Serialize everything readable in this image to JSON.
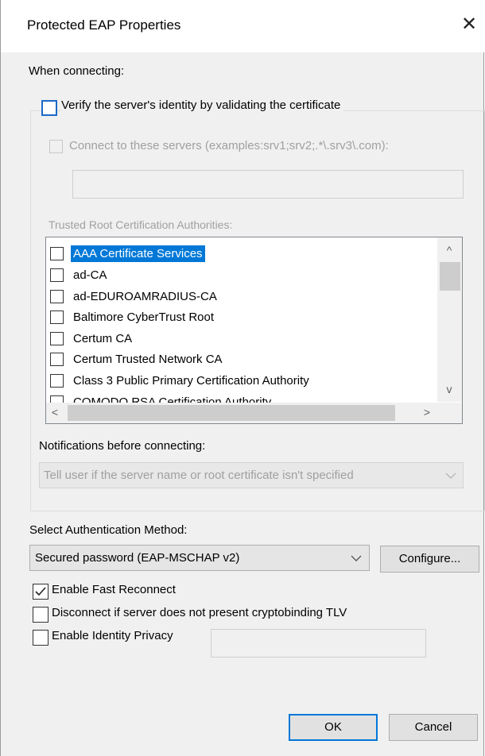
{
  "window": {
    "title": "Protected EAP Properties",
    "close_glyph": "✕"
  },
  "when_connecting": {
    "label": "When connecting:"
  },
  "verify_server": {
    "label": "Verify the server's identity by validating the certificate",
    "checked": false
  },
  "connect_servers": {
    "label": "Connect to these servers (examples:srv1;srv2;.*\\.srv3\\.com):",
    "checked": false,
    "value": ""
  },
  "trusted_roots": {
    "label": "Trusted Root Certification Authorities:",
    "items": [
      {
        "label": "AAA Certificate Services",
        "checked": false,
        "selected": true
      },
      {
        "label": "ad-CA",
        "checked": false
      },
      {
        "label": "ad-EDUROAMRADIUS-CA",
        "checked": false
      },
      {
        "label": "Baltimore CyberTrust Root",
        "checked": false
      },
      {
        "label": "Certum CA",
        "checked": false
      },
      {
        "label": "Certum Trusted Network CA",
        "checked": false
      },
      {
        "label": "Class 3 Public Primary Certification Authority",
        "checked": false
      },
      {
        "label": "COMODO RSA Certification Authority",
        "checked": false
      }
    ],
    "scroll_up": "^",
    "scroll_down": "v",
    "scroll_left": "<",
    "scroll_right": ">"
  },
  "notifications": {
    "label": "Notifications before connecting:",
    "value": "Tell user if the server name or root certificate isn't specified"
  },
  "auth_method": {
    "label": "Select Authentication Method:",
    "value": "Secured password (EAP-MSCHAP v2)",
    "configure_label": "Configure..."
  },
  "options": {
    "fast_reconnect": {
      "label": "Enable Fast Reconnect",
      "checked": true
    },
    "cryptobinding": {
      "label": "Disconnect if server does not present cryptobinding TLV",
      "checked": false
    },
    "identity_privacy": {
      "label": "Enable Identity Privacy",
      "checked": false,
      "value": ""
    }
  },
  "buttons": {
    "ok": "OK",
    "cancel": "Cancel"
  }
}
